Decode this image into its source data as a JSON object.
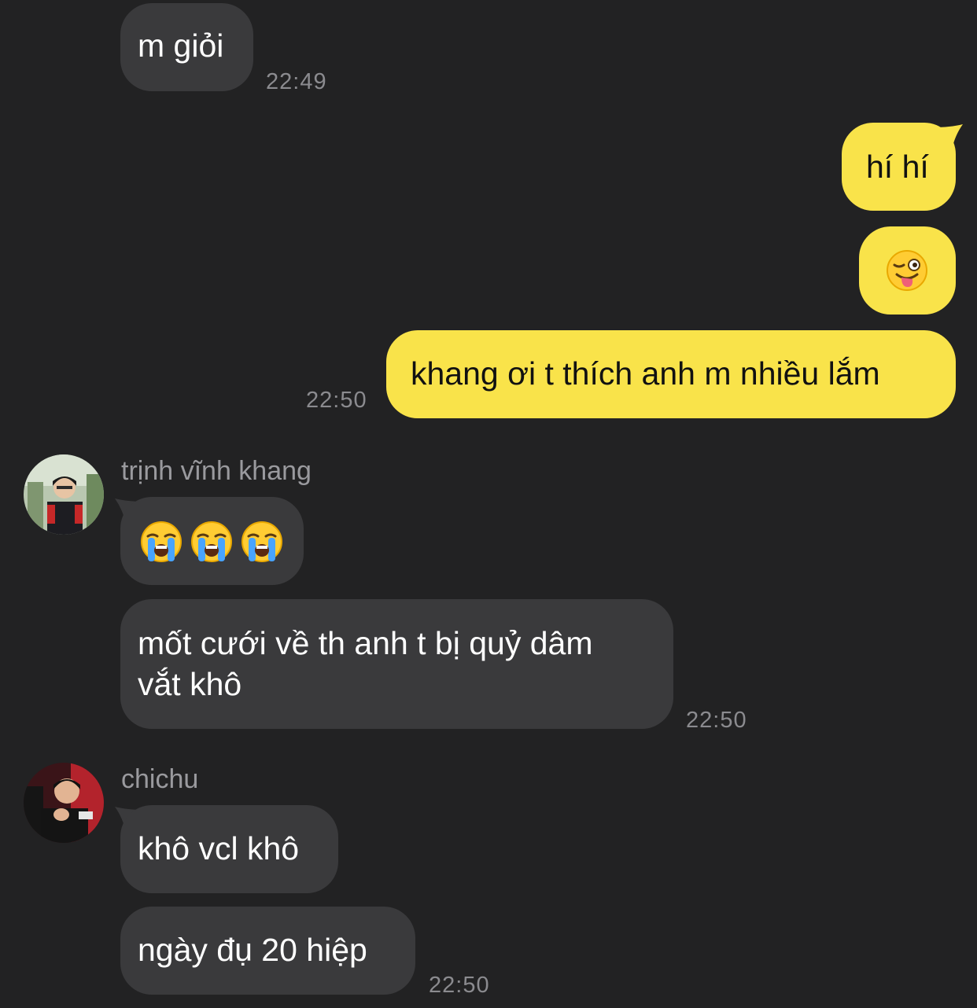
{
  "messages": [
    {
      "id": "m1",
      "direction": "incoming",
      "text": "m giỏi",
      "time": "22:49"
    },
    {
      "id": "m2",
      "direction": "outgoing",
      "text": "hí hí"
    },
    {
      "id": "m3",
      "direction": "outgoing",
      "emoji": "winking-face-with-tongue"
    },
    {
      "id": "m4",
      "direction": "outgoing",
      "text": "khang ơi t thích anh m nhiều lắm",
      "time": "22:50"
    },
    {
      "id": "m5",
      "direction": "incoming",
      "sender": "trịnh vĩnh khang",
      "emoji": [
        "loudly-crying-face",
        "loudly-crying-face",
        "loudly-crying-face"
      ]
    },
    {
      "id": "m6",
      "direction": "incoming",
      "text_line1": "mốt cưới về th anh t bị quỷ dâm",
      "text_line2": "vắt khô",
      "time": "22:50"
    },
    {
      "id": "m7",
      "direction": "incoming",
      "sender": "chichu",
      "text": "khô vcl khô"
    },
    {
      "id": "m8",
      "direction": "incoming",
      "text": "ngày đụ 20 hiệp",
      "time": "22:50"
    }
  ],
  "colors": {
    "background": "#222223",
    "incoming_bubble": "#3a3a3c",
    "outgoing_bubble": "#f9e34a",
    "timestamp": "#8b8b8f",
    "sender_name": "#9a9a9e"
  }
}
